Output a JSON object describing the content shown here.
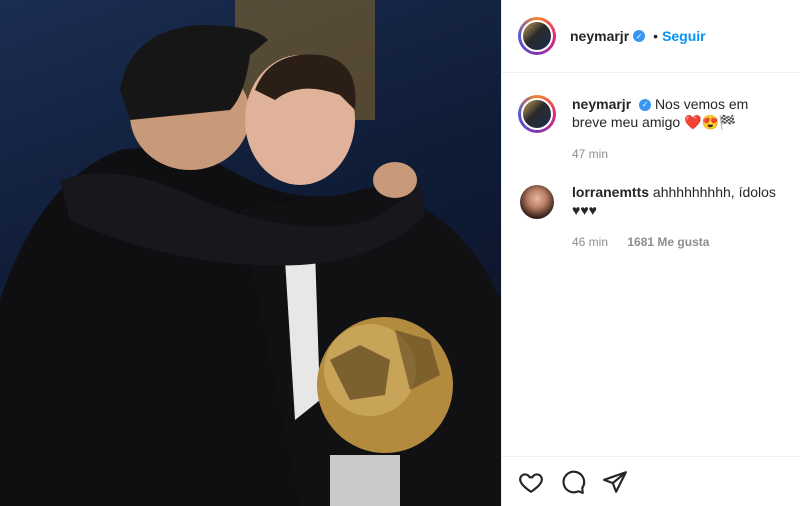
{
  "post": {
    "photo": {
      "description_icon": "photo"
    },
    "header": {
      "username": "neymarjr",
      "follow_separator": "•",
      "follow_label": "Seguir"
    },
    "caption": {
      "username": "neymarjr",
      "text": "Nos vemos em breve meu amigo",
      "emojis": "❤️😍🏁",
      "time": "47 min"
    },
    "comments": [
      {
        "username": "lorranemtts",
        "text": "ahhhhhhhhh, ídolos",
        "extra": "♥♥♥",
        "time": "46 min",
        "likes": "1681 Me gusta"
      }
    ],
    "actions": {
      "like": "heart-icon",
      "comment": "comment-icon",
      "share": "share-icon"
    }
  }
}
